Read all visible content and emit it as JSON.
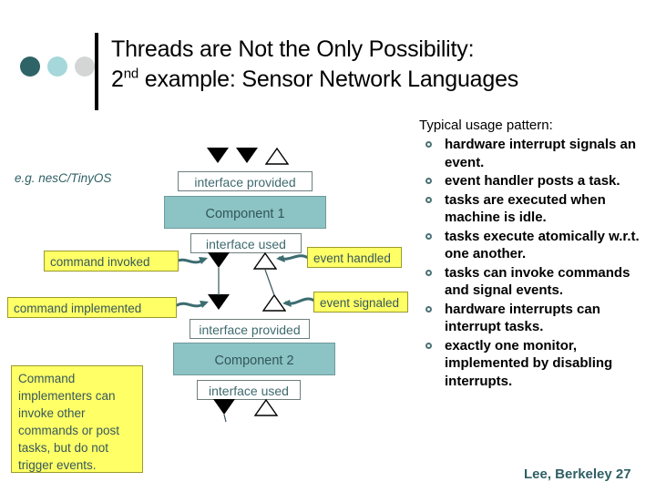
{
  "slide": {
    "title_line1": "Threads are Not the Only Possibility:",
    "title_line2_pre": "2",
    "title_line2_sup": "nd",
    "title_line2_post": " example: Sensor Network Languages",
    "footer": "Lee, Berkeley 27"
  },
  "decor": {
    "dot1_color": "#2e6367",
    "dot2_color": "#a6d7da",
    "dot3_color": "#d4d6d6"
  },
  "diagram": {
    "example_label": "e.g. nesC/TinyOS",
    "interface_provided_1": "interface provided",
    "component_1": "Component 1",
    "interface_used_1": "interface used",
    "interface_provided_2": "interface provided",
    "component_2": "Component 2",
    "interface_used_2": "interface used",
    "callout_command_invoked": "command invoked",
    "callout_event_handled": "event handled",
    "callout_command_implemented": "command implemented",
    "callout_event_signaled": "event signaled",
    "note_box": "Command implementers can invoke other commands or post tasks, but do not trigger events.",
    "component_color": "#8cc3c4",
    "callout_color": "#ffff66",
    "accent_color": "#2f6064"
  },
  "usage": {
    "heading": "Typical usage pattern:",
    "bullets": [
      "hardware interrupt signals an event.",
      "event handler posts a task.",
      "tasks are executed when machine is idle.",
      "tasks execute atomically w.r.t. one another.",
      "tasks can invoke commands and signal events.",
      "hardware interrupts can interrupt tasks.",
      "exactly one monitor, implemented by disabling interrupts."
    ]
  }
}
